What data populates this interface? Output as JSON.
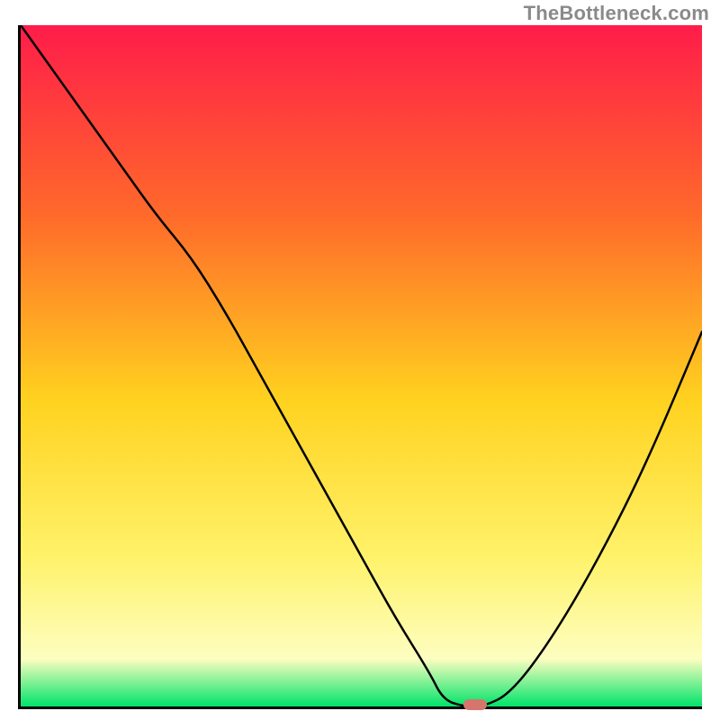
{
  "watermark": "TheBottleneck.com",
  "chart_data": {
    "type": "line",
    "title": "",
    "xlabel": "",
    "ylabel": "",
    "xlim": [
      0,
      100
    ],
    "ylim": [
      0,
      100
    ],
    "x": [
      0,
      5,
      10,
      15,
      20,
      25,
      30,
      35,
      40,
      45,
      50,
      55,
      60,
      62,
      65,
      68,
      72,
      78,
      85,
      92,
      100
    ],
    "values": [
      100,
      93,
      86,
      79,
      72,
      66,
      58,
      49,
      40,
      31,
      22,
      13,
      5,
      1,
      0,
      0,
      2,
      10,
      22,
      36,
      55
    ],
    "gradient_colors": {
      "top": "#ff1c4a",
      "mid_upper": "#ff8a1f",
      "mid": "#ffd21f",
      "mid_lower": "#fff26a",
      "near_bottom": "#fdfec0",
      "bottom": "#00e36a"
    },
    "marker": {
      "x": 66.5,
      "y": 0.6
    }
  }
}
